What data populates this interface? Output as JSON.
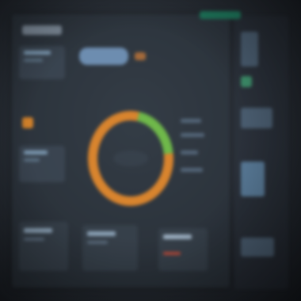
{
  "colors": {
    "background": "#22272e",
    "panel": "#303842",
    "donut_orange": "#d8842e",
    "donut_green": "#6fb84a",
    "accent_blue": "#6d8db0",
    "accent_green": "#1f7a5e"
  },
  "dashboard": {
    "donut_segments": [
      {
        "name": "orange",
        "fraction": 0.8,
        "color": "#d8842e"
      },
      {
        "name": "green",
        "fraction": 0.2,
        "color": "#6fb84a"
      }
    ]
  }
}
